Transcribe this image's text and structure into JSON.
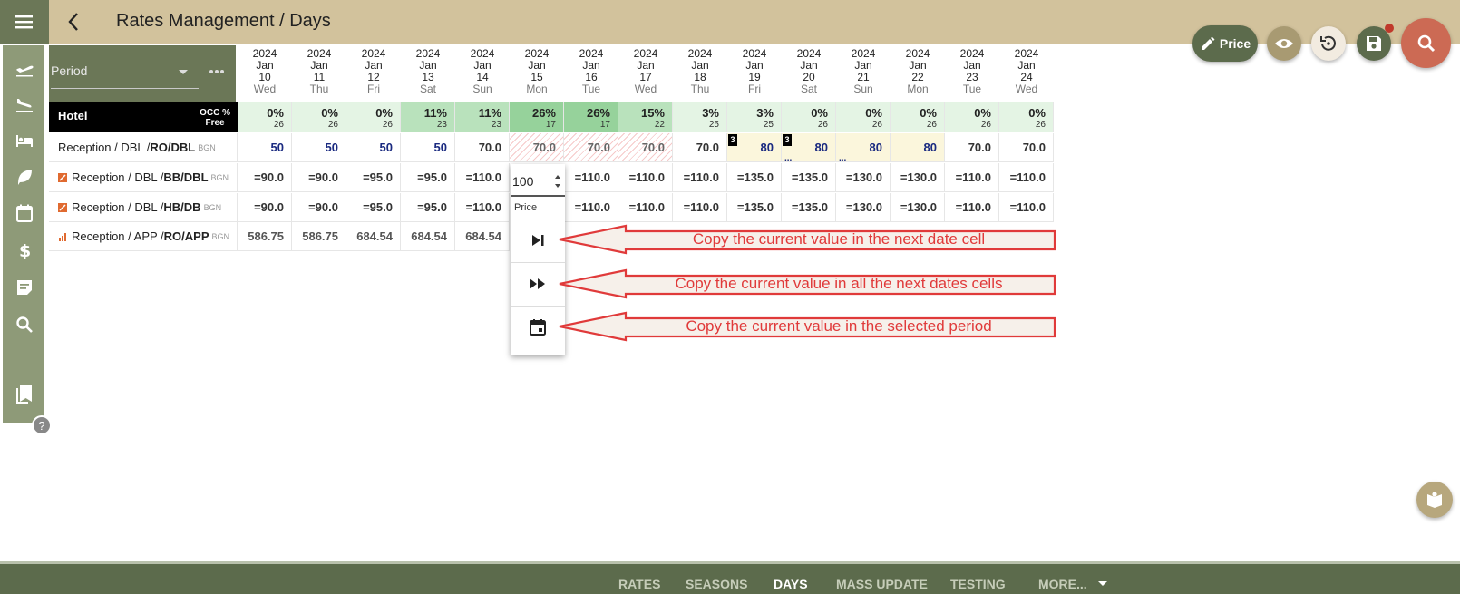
{
  "header": {
    "title": "Rates Management / Days",
    "price_button": "Price"
  },
  "colors": {
    "topbar": "#d2c29c",
    "sidebar": "#8e9a78",
    "primary": "#5c6b4c",
    "search_fab": "#cc6a54",
    "annotation": "#e03a3a"
  },
  "period": {
    "label": "Period"
  },
  "dates": [
    {
      "year": "2024",
      "month": "Jan",
      "day": "10",
      "dow": "Wed"
    },
    {
      "year": "2024",
      "month": "Jan",
      "day": "11",
      "dow": "Thu"
    },
    {
      "year": "2024",
      "month": "Jan",
      "day": "12",
      "dow": "Fri"
    },
    {
      "year": "2024",
      "month": "Jan",
      "day": "13",
      "dow": "Sat"
    },
    {
      "year": "2024",
      "month": "Jan",
      "day": "14",
      "dow": "Sun"
    },
    {
      "year": "2024",
      "month": "Jan",
      "day": "15",
      "dow": "Mon"
    },
    {
      "year": "2024",
      "month": "Jan",
      "day": "16",
      "dow": "Tue"
    },
    {
      "year": "2024",
      "month": "Jan",
      "day": "17",
      "dow": "Wed"
    },
    {
      "year": "2024",
      "month": "Jan",
      "day": "18",
      "dow": "Thu"
    },
    {
      "year": "2024",
      "month": "Jan",
      "day": "19",
      "dow": "Fri"
    },
    {
      "year": "2024",
      "month": "Jan",
      "day": "20",
      "dow": "Sat"
    },
    {
      "year": "2024",
      "month": "Jan",
      "day": "21",
      "dow": "Sun"
    },
    {
      "year": "2024",
      "month": "Jan",
      "day": "22",
      "dow": "Mon"
    },
    {
      "year": "2024",
      "month": "Jan",
      "day": "23",
      "dow": "Tue"
    },
    {
      "year": "2024",
      "month": "Jan",
      "day": "24",
      "dow": "Wed"
    }
  ],
  "hotel": {
    "name": "Hotel",
    "occ_label": "OCC %",
    "free_label": "Free"
  },
  "occupancy": [
    {
      "pct": "0%",
      "free": "26",
      "color": "#e4f4e4"
    },
    {
      "pct": "0%",
      "free": "26",
      "color": "#e4f4e4"
    },
    {
      "pct": "0%",
      "free": "26",
      "color": "#e4f4e4"
    },
    {
      "pct": "11%",
      "free": "23",
      "color": "#b9e2bc"
    },
    {
      "pct": "11%",
      "free": "23",
      "color": "#b9e2bc"
    },
    {
      "pct": "26%",
      "free": "17",
      "color": "#96d29b"
    },
    {
      "pct": "26%",
      "free": "17",
      "color": "#96d29b"
    },
    {
      "pct": "15%",
      "free": "22",
      "color": "#b9e2bc"
    },
    {
      "pct": "3%",
      "free": "25",
      "color": "#e4f4e4"
    },
    {
      "pct": "3%",
      "free": "25",
      "color": "#e4f4e4"
    },
    {
      "pct": "0%",
      "free": "26",
      "color": "#e4f4e4"
    },
    {
      "pct": "0%",
      "free": "26",
      "color": "#e4f4e4"
    },
    {
      "pct": "0%",
      "free": "26",
      "color": "#e4f4e4"
    },
    {
      "pct": "0%",
      "free": "26",
      "color": "#e4f4e4"
    },
    {
      "pct": "0%",
      "free": "26",
      "color": "#e4f4e4"
    }
  ],
  "rows": [
    {
      "prefix": "Reception / DBL /",
      "code": "RO/DBL",
      "currency": "BGN",
      "icon": "",
      "values": [
        "50",
        "50",
        "50",
        "50",
        "70.0",
        "70.0",
        "70.0",
        "70.0",
        "70.0",
        "80",
        "80",
        "80",
        "80",
        "70.0",
        "70.0"
      ]
    },
    {
      "prefix": "Reception / DBL /",
      "code": "BB/DBL",
      "currency": "BGN",
      "icon": "derived-rate-icon",
      "values": [
        "=90.0",
        "=90.0",
        "=95.0",
        "=95.0",
        "=110.0",
        "",
        "=110.0",
        "=110.0",
        "=110.0",
        "=135.0",
        "=135.0",
        "=130.0",
        "=130.0",
        "=110.0",
        "=110.0"
      ]
    },
    {
      "prefix": "Reception / DBL /",
      "code": "HB/DB",
      "currency": "BGN",
      "icon": "derived-rate-icon",
      "values": [
        "=90.0",
        "=90.0",
        "=95.0",
        "=95.0",
        "=110.0",
        "",
        "=110.0",
        "=110.0",
        "=110.0",
        "=135.0",
        "=135.0",
        "=130.0",
        "=130.0",
        "=110.0",
        "=110.0"
      ]
    },
    {
      "prefix": "Reception / APP /",
      "code": "RO/APP",
      "currency": "BGN",
      "icon": "bar-chart-icon",
      "values": [
        "586.75",
        "586.75",
        "684.54",
        "684.54",
        "684.54"
      ]
    }
  ],
  "badges": {
    "count": "3",
    "more": "..."
  },
  "popup": {
    "value": "100",
    "price_label": "Price"
  },
  "annotations": [
    "Copy the current value in the next date cell",
    "Copy the current value in all the next dates cells",
    "Copy the current value in the selected period"
  ],
  "bottom_tabs": [
    "RATES",
    "SEASONS",
    "DAYS",
    "MASS UPDATE",
    "TESTING",
    "MORE..."
  ],
  "active_tab": "DAYS"
}
